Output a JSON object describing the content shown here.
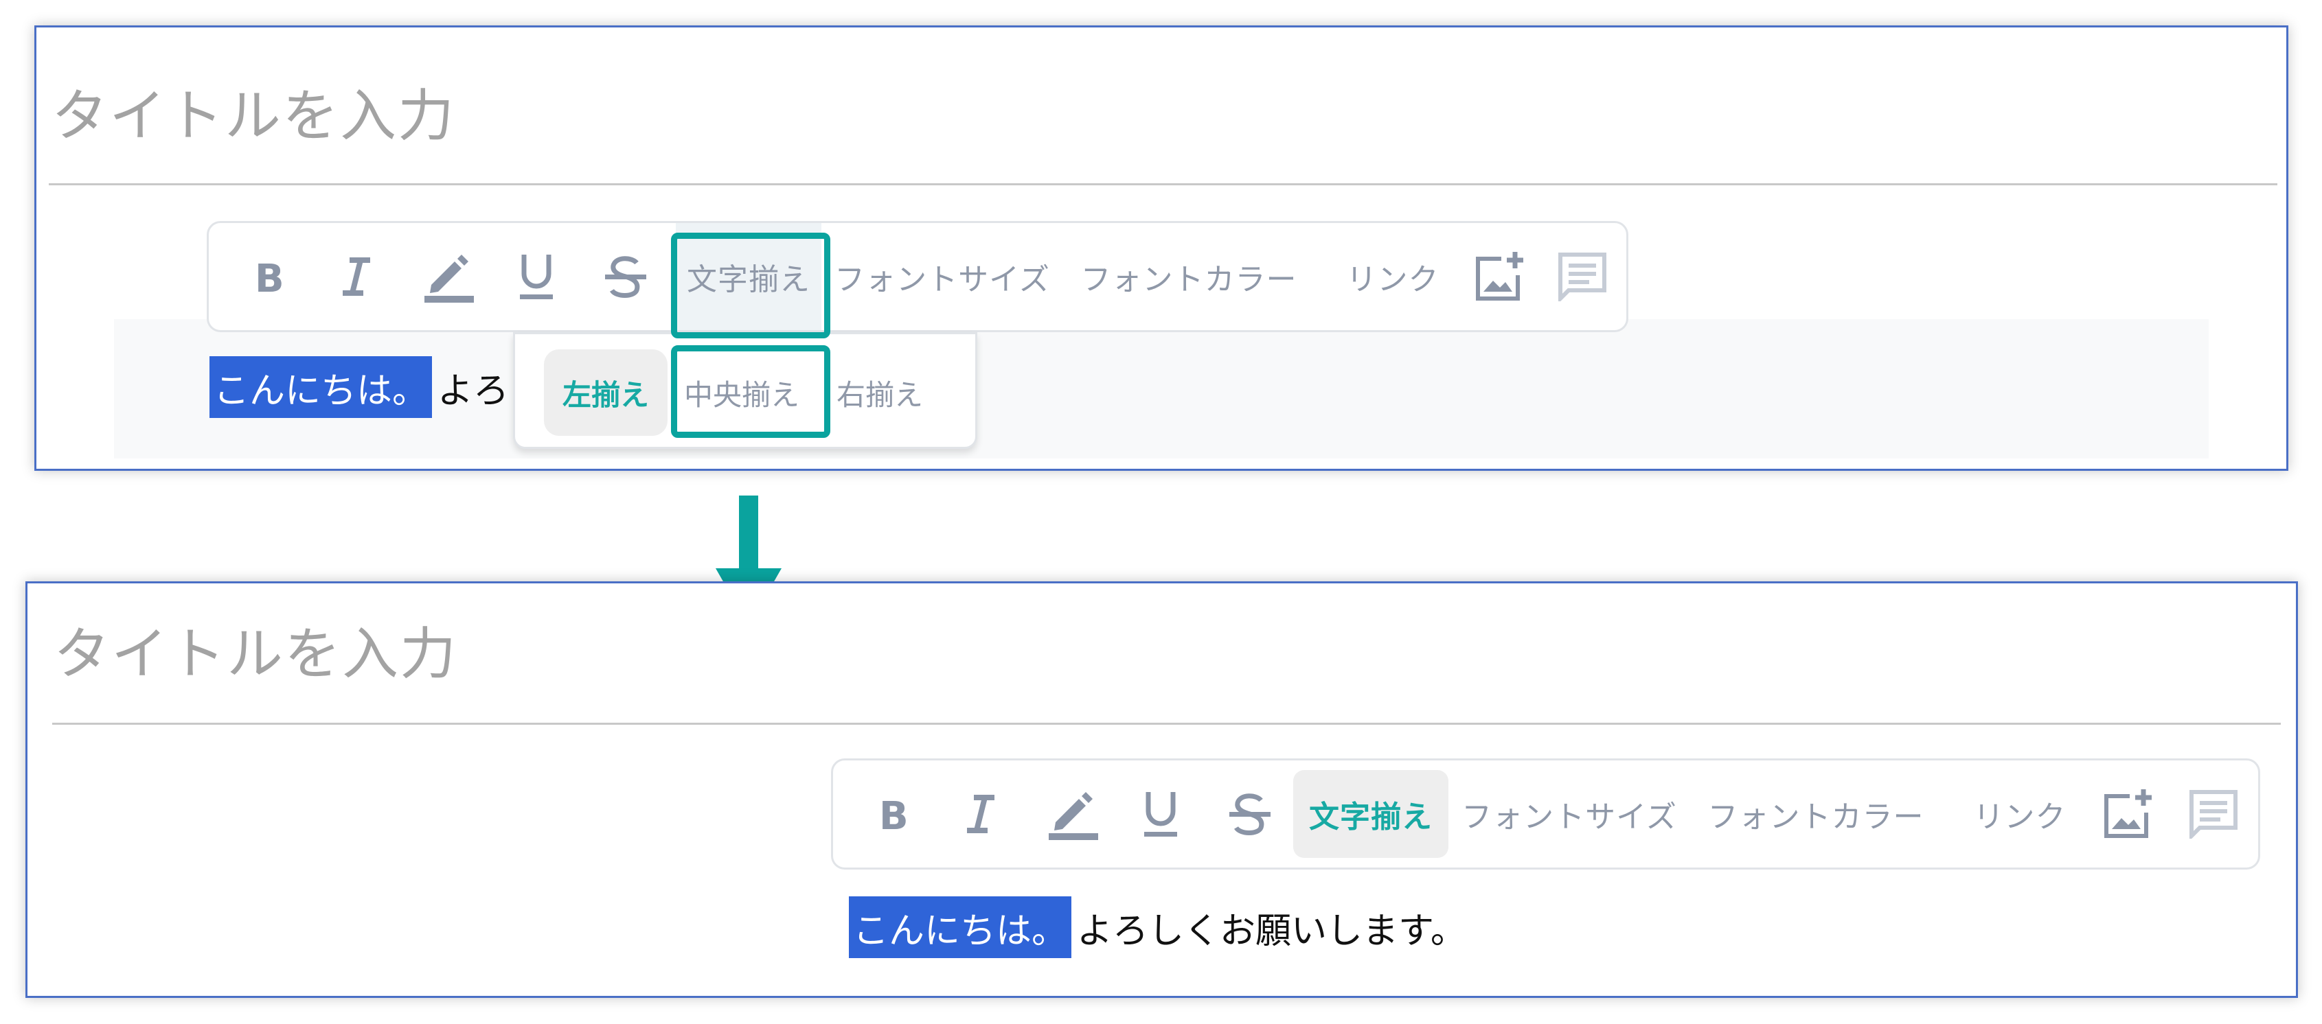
{
  "title_placeholder": "タイトルを入力",
  "colors": {
    "accent_teal": "#0aa39e",
    "selection_blue": "#2f64d8",
    "panel_border": "#4a6fc6",
    "icon_gray": "#8a94a6"
  },
  "toolbar": {
    "bold_icon": "bold-icon",
    "italic_icon": "italic-icon",
    "highlight_icon": "highlighter-pen-icon",
    "underline_icon": "underline-icon",
    "strike_icon": "strikethrough-icon",
    "align_label": "文字揃え",
    "font_size_label": "フォントサイズ",
    "font_color_label": "フォントカラー",
    "link_label": "リンク",
    "image_icon": "add-image-icon",
    "comment_icon": "comment-icon"
  },
  "align_menu": {
    "left": "左揃え",
    "center": "中央揃え",
    "right": "右揃え"
  },
  "before": {
    "selected_text": "こんにちは。",
    "rest_text": "よろ"
  },
  "after": {
    "selected_text": "こんにちは。",
    "rest_text": "よろしくお願いします。"
  }
}
